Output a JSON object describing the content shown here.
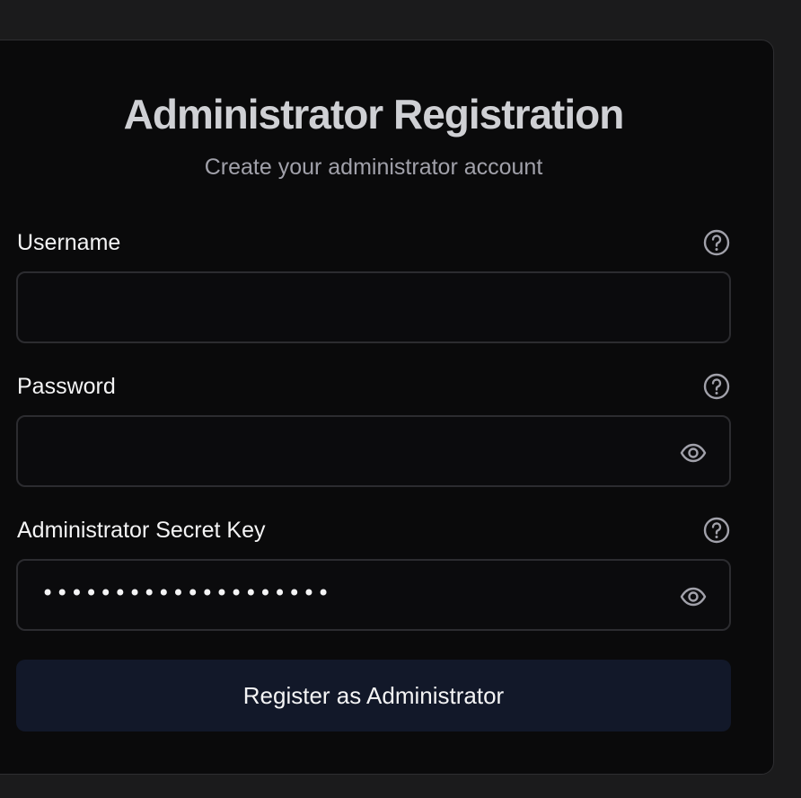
{
  "form": {
    "title": "Administrator Registration",
    "subtitle": "Create your administrator account",
    "fields": [
      {
        "label": "Username",
        "value": "",
        "placeholder": "",
        "help_icon": "question-circle-icon"
      },
      {
        "label": "Password",
        "value": "",
        "placeholder": "",
        "help_icon": "question-circle-icon",
        "toggle_icon": "eye-icon"
      },
      {
        "label": "Administrator Secret Key",
        "masked_value": "••••••••••••••••••••",
        "help_icon": "question-circle-icon",
        "toggle_icon": "eye-icon"
      }
    ],
    "submit_label": "Register as Administrator"
  },
  "colors": {
    "page_background": "#1b1b1c",
    "card_background": "#0a0a0b",
    "button_background": "#121829",
    "text": "#f4f4f5",
    "muted_text": "#a1a1aa"
  }
}
